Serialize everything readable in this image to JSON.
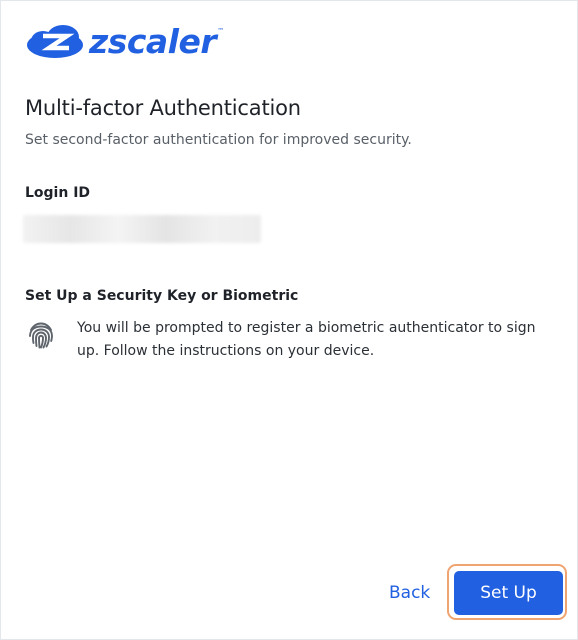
{
  "brand": {
    "name": "zscaler",
    "trademark": "™",
    "color": "#2160e1",
    "icon": "zscaler-cloud-icon"
  },
  "header": {
    "title": "Multi-factor Authentication",
    "subtitle": "Set second-factor authentication for improved security."
  },
  "login": {
    "label": "Login ID",
    "value": "",
    "redacted": true
  },
  "security_key": {
    "heading": "Set Up a Security Key or Biometric",
    "icon": "fingerprint-icon",
    "description": "You will be prompted to register a biometric authenticator to sign up. Follow the instructions on your device."
  },
  "actions": {
    "back_label": "Back",
    "setup_label": "Set Up",
    "primary_color": "#2160e1",
    "focus_ring_color": "#f0a471"
  }
}
